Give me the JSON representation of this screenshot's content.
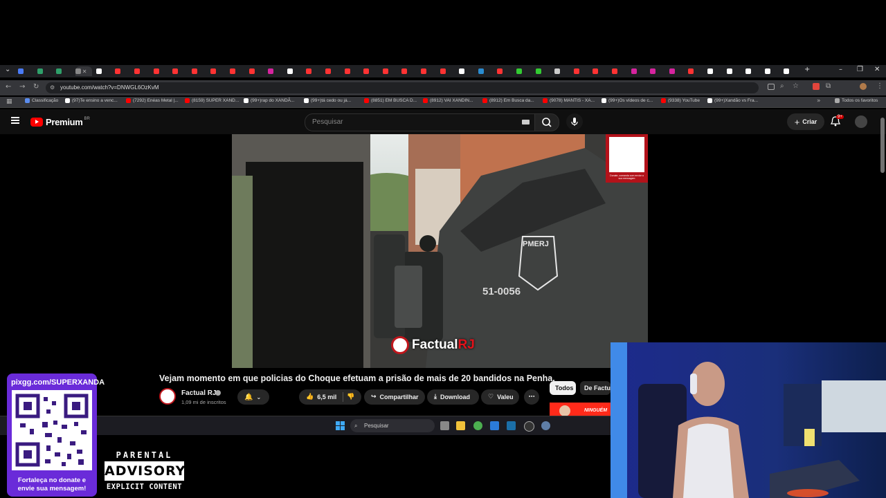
{
  "browser": {
    "url": "youtube.com/watch?v=DNWGL6OzKvM",
    "bookmarks": [
      {
        "label": "Classificação",
        "color": "#5b8def"
      },
      {
        "label": "(97)Te ensino a venc...",
        "color": "#ffffff"
      },
      {
        "label": "(7292) Enéas Metal |...",
        "color": "#ff0000"
      },
      {
        "label": "(8159) SUPER XAND...",
        "color": "#ff0000"
      },
      {
        "label": "(99+)rap do XANDÃ...",
        "color": "#ffffff"
      },
      {
        "label": "(99+)tá cedo ou já...",
        "color": "#ffffff"
      },
      {
        "label": "(8851) EM BUSCA D...",
        "color": "#ff0000"
      },
      {
        "label": "(8912) VAI XANDIN...",
        "color": "#ff0000"
      },
      {
        "label": "(8912) Em Busca da...",
        "color": "#ff0000"
      },
      {
        "label": "(9078) MANTIS - XA...",
        "color": "#ff0000"
      },
      {
        "label": "(99+)Os vídeos de c...",
        "color": "#ffffff"
      },
      {
        "label": "(9338) YouTube",
        "color": "#ff0000"
      },
      {
        "label": "(99+)Xandão vs Fra...",
        "color": "#ffffff"
      }
    ],
    "all_bookmarks": "Todos os favoritos"
  },
  "youtube": {
    "logo_text": "Premium",
    "region": "BR",
    "search_placeholder": "Pesquisar",
    "create_label": "Criar",
    "notif_badge": "9+"
  },
  "video": {
    "watermark_part1": "Factual",
    "watermark_part2": "RJ",
    "qr_caption": "Donate, comanda com enviar a sua mensagem",
    "vehicle_text": "PMERJ",
    "vehicle_number": "51-0056",
    "title": "Vejam momento em que policias do Choque efetuam a prisão de mais de 20 bandidos na Penha.",
    "channel_name": "Factual RJ",
    "subscribers": "1,09 mi de inscritos",
    "likes": "6,5 mil",
    "share_label": "Compartilhar",
    "download_label": "Download",
    "thanks_label": "Valeu",
    "chips": [
      "Todos",
      "De Factual"
    ],
    "thumb_text": "NINGUÉM"
  },
  "taskbar": {
    "search_placeholder": "Pesquisar"
  },
  "overlay": {
    "donate_url": "pixgg.com/SUPERXANDA",
    "donate_cta": "Fortaleça no donate e envie sua mensagem!",
    "advisory_top": "PARENTAL",
    "advisory_mid": "ADVISORY",
    "advisory_bottom": "EXPLICIT CONTENT"
  }
}
